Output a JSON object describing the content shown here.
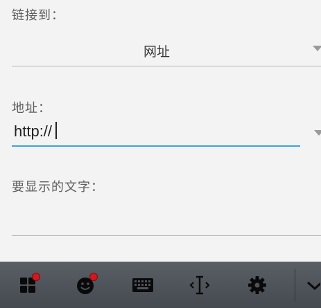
{
  "dialog": {
    "link_to_label": "链接到：",
    "link_type_value": "网址",
    "address_label": "地址：",
    "address_value": "http://",
    "display_text_label": "要显示的文字：",
    "display_text_value": "",
    "accent_color": "#3ba2dc"
  },
  "toolbar": {
    "buttons": [
      {
        "icon": "apps-icon",
        "has_badge": true
      },
      {
        "icon": "emoji-icon",
        "has_badge": true
      },
      {
        "icon": "keyboard-icon",
        "has_badge": false
      },
      {
        "icon": "text-cursor-icon",
        "has_badge": false
      },
      {
        "icon": "gear-icon",
        "has_badge": false
      },
      {
        "icon": "chevron-down-icon",
        "has_badge": false
      }
    ],
    "badge_color": "#d0181f"
  }
}
